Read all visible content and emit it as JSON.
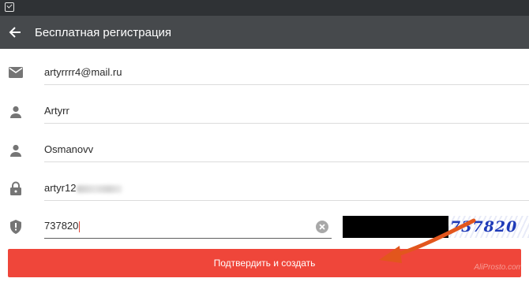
{
  "statusbar": {
    "icon": "notification-icon"
  },
  "appbar": {
    "back_icon": "arrow-left-icon",
    "title": "Бесплатная регистрация"
  },
  "form": {
    "email": {
      "icon": "envelope-icon",
      "value": "artyrrrr4@mail.ru"
    },
    "first_name": {
      "icon": "person-icon",
      "value": "Artyrr"
    },
    "last_name": {
      "icon": "person-icon",
      "value": "Osmanovv"
    },
    "password": {
      "icon": "lock-icon",
      "value_visible": "artyr12"
    },
    "captcha": {
      "icon": "shield-icon",
      "value": "737820",
      "image_text": "737820",
      "clear_icon": "clear-circle-icon"
    }
  },
  "submit_label": "Подтвердить и создать",
  "watermark": "AliProstо.com",
  "colors": {
    "appbar": "#46494c",
    "statusbar": "#2f3235",
    "accent": "#ef463a",
    "arrow": "#e2561d"
  }
}
